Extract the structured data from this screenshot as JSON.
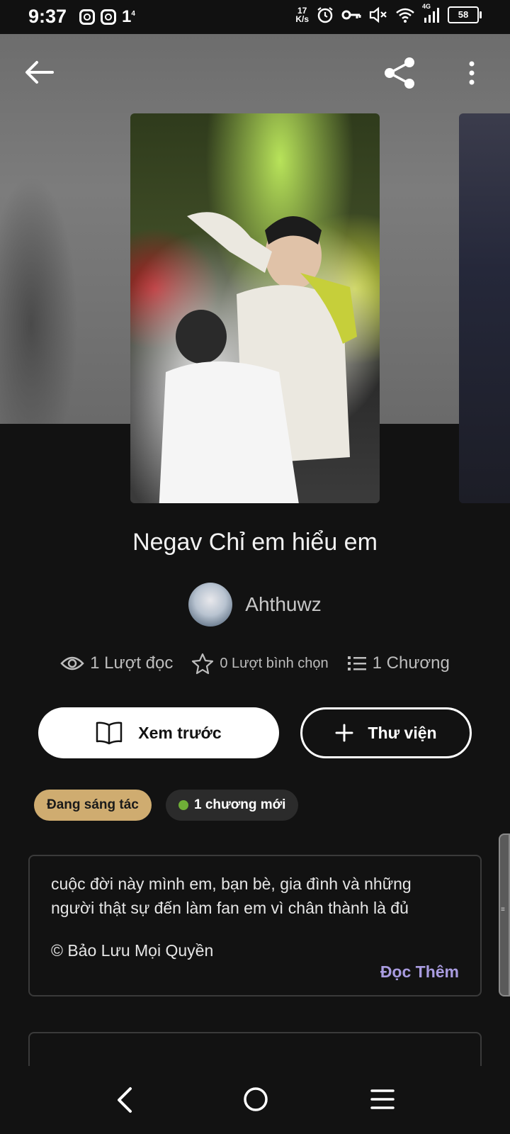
{
  "status_bar": {
    "time": "9:37",
    "one_label": "1",
    "one_sup": "4",
    "net_speed_value": "17",
    "net_speed_unit": "K/s",
    "network_type": "4G",
    "battery": "58"
  },
  "top_bar": {
    "back_icon": "arrow-left-icon",
    "share_icon": "share-icon",
    "more_icon": "more-vertical-icon"
  },
  "book": {
    "title": "Negav Chỉ em hiểu em",
    "author": "Ahthuwz"
  },
  "stats": {
    "reads": "1 Lượt đọc",
    "votes": "0 Lượt bình chọn",
    "chapters": "1 Chương"
  },
  "actions": {
    "preview_label": "Xem trước",
    "library_label": "Thư viện"
  },
  "tags": {
    "status": "Đang sáng tác",
    "new_chapter": "1 chương mới"
  },
  "description": {
    "text": "cuộc đời này mình em, bạn bè, gia đình và những người thật sự đến làm fan em vì chân thành là đủ",
    "copyright": "© Bảo Lưu Mọi Quyền",
    "read_more": "Đọc Thêm"
  },
  "colors": {
    "background": "#121212",
    "status_tag": "#cfac70",
    "read_more": "#a99ce0",
    "new_dot": "#6fae37"
  }
}
